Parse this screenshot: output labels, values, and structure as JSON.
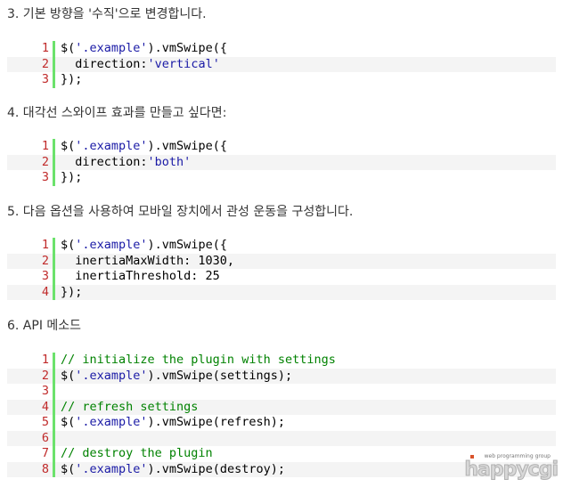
{
  "sections": [
    {
      "heading": "3. 기본 방향을 '수직'으로 변경합니다.",
      "lines": [
        {
          "num": "1",
          "tokens": [
            {
              "t": "$(",
              "c": "plain"
            },
            {
              "t": "'.example'",
              "c": "str"
            },
            {
              "t": ").vmSwipe({",
              "c": "plain"
            }
          ]
        },
        {
          "num": "2",
          "tokens": [
            {
              "t": "  direction:",
              "c": "plain"
            },
            {
              "t": "'vertical'",
              "c": "str"
            }
          ]
        },
        {
          "num": "3",
          "tokens": [
            {
              "t": "});",
              "c": "plain"
            }
          ]
        }
      ]
    },
    {
      "heading": "4. 대각선 스와이프 효과를 만들고 싶다면:",
      "lines": [
        {
          "num": "1",
          "tokens": [
            {
              "t": "$(",
              "c": "plain"
            },
            {
              "t": "'.example'",
              "c": "str"
            },
            {
              "t": ").vmSwipe({",
              "c": "plain"
            }
          ]
        },
        {
          "num": "2",
          "tokens": [
            {
              "t": "  direction:",
              "c": "plain"
            },
            {
              "t": "'both'",
              "c": "str"
            }
          ]
        },
        {
          "num": "3",
          "tokens": [
            {
              "t": "});",
              "c": "plain"
            }
          ]
        }
      ]
    },
    {
      "heading": "5. 다음 옵션을 사용하여 모바일 장치에서 관성 운동을 구성합니다.",
      "lines": [
        {
          "num": "1",
          "tokens": [
            {
              "t": "$(",
              "c": "plain"
            },
            {
              "t": "'.example'",
              "c": "str"
            },
            {
              "t": ").vmSwipe({",
              "c": "plain"
            }
          ]
        },
        {
          "num": "2",
          "tokens": [
            {
              "t": "  inertiaMaxWidth: 1030,",
              "c": "plain"
            }
          ]
        },
        {
          "num": "3",
          "tokens": [
            {
              "t": "  inertiaThreshold: 25",
              "c": "plain"
            }
          ]
        },
        {
          "num": "4",
          "tokens": [
            {
              "t": "});",
              "c": "plain"
            }
          ]
        }
      ]
    },
    {
      "heading": "6. API 메소드",
      "lines": [
        {
          "num": "1",
          "tokens": [
            {
              "t": "// initialize the plugin with settings",
              "c": "comment"
            }
          ]
        },
        {
          "num": "2",
          "tokens": [
            {
              "t": "$(",
              "c": "plain"
            },
            {
              "t": "'.example'",
              "c": "str"
            },
            {
              "t": ").vmSwipe(settings);",
              "c": "plain"
            }
          ]
        },
        {
          "num": "3",
          "tokens": []
        },
        {
          "num": "4",
          "tokens": [
            {
              "t": "// refresh settings",
              "c": "comment"
            }
          ]
        },
        {
          "num": "5",
          "tokens": [
            {
              "t": "$(",
              "c": "plain"
            },
            {
              "t": "'.example'",
              "c": "str"
            },
            {
              "t": ").vmSwipe(refresh);",
              "c": "plain"
            }
          ]
        },
        {
          "num": "6",
          "tokens": []
        },
        {
          "num": "7",
          "tokens": [
            {
              "t": "// destroy the plugin",
              "c": "comment"
            }
          ]
        },
        {
          "num": "8",
          "tokens": [
            {
              "t": "$(",
              "c": "plain"
            },
            {
              "t": "'.example'",
              "c": "str"
            },
            {
              "t": ").vmSwipe(destroy);",
              "c": "plain"
            }
          ]
        }
      ]
    }
  ],
  "watermark": {
    "tagline": "web programming group",
    "logo": "happycgi"
  },
  "colors": {
    "line_number": "#c02a2a",
    "gutter_border": "#6ce26c",
    "string": "#1a1aa6",
    "comment": "#008200",
    "stripe": "#f4f4f4"
  }
}
